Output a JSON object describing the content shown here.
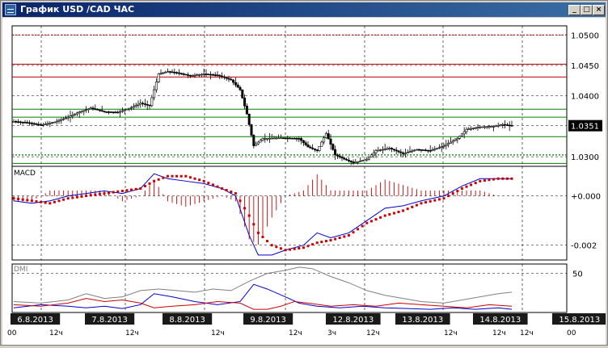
{
  "window": {
    "title": "График USD /CAD  ЧАС",
    "minimize_label": "_",
    "maximize_label": "□",
    "close_label": "×"
  },
  "colors": {
    "background": "#ffffff",
    "grid": "#000000",
    "resistance_line": "#c00000",
    "support_line": "#008000",
    "macd_line": "#0000cc",
    "signal_line": "#cc0000",
    "dmi_adx": "#808080",
    "dmi_plus": "#0000cc",
    "dmi_minus": "#cc0000",
    "date_label_bg": "#1a1a1a"
  },
  "chart_data": [
    {
      "type": "candlestick",
      "symbol": "USD /CAD",
      "timeframe": "ЧАС",
      "y_ticks": [
        "1.0500",
        "1.0450",
        "1.0400",
        "1.0351",
        "1.0300"
      ],
      "y_tick_values": [
        1.05,
        1.045,
        1.04,
        1.0351,
        1.03
      ],
      "current_price": "1.0351",
      "ylim": [
        1.0263,
        1.0515
      ],
      "horizontal_levels": {
        "dotted_red": [
          1.05
        ],
        "red": [
          1.0452,
          1.0431
        ],
        "green": [
          1.0378,
          1.0365,
          1.0333,
          1.0289,
          1.0279
        ],
        "dotted_green": [
          1.0303
        ]
      },
      "close_path": [
        [
          0,
          1.0358
        ],
        [
          6,
          1.0356
        ],
        [
          12,
          1.0352
        ],
        [
          18,
          1.0357
        ],
        [
          24,
          1.0365
        ],
        [
          28,
          1.0372
        ],
        [
          34,
          1.038
        ],
        [
          40,
          1.0374
        ],
        [
          46,
          1.0373
        ],
        [
          52,
          1.0381
        ],
        [
          56,
          1.0388
        ],
        [
          60,
          1.0384
        ],
        [
          64,
          1.0436
        ],
        [
          68,
          1.044
        ],
        [
          72,
          1.0438
        ],
        [
          78,
          1.0433
        ],
        [
          84,
          1.0436
        ],
        [
          90,
          1.0434
        ],
        [
          96,
          1.0426
        ],
        [
          100,
          1.041
        ],
        [
          103,
          1.037
        ],
        [
          106,
          1.0318
        ],
        [
          110,
          1.033
        ],
        [
          118,
          1.0331
        ],
        [
          126,
          1.033
        ],
        [
          130,
          1.0316
        ],
        [
          134,
          1.031
        ],
        [
          138,
          1.0338
        ],
        [
          142,
          1.0303
        ],
        [
          146,
          1.0296
        ],
        [
          150,
          1.029
        ],
        [
          156,
          1.0296
        ],
        [
          160,
          1.031
        ],
        [
          166,
          1.0314
        ],
        [
          172,
          1.0305
        ],
        [
          178,
          1.0312
        ],
        [
          184,
          1.031
        ],
        [
          190,
          1.0318
        ],
        [
          196,
          1.033
        ],
        [
          200,
          1.0345
        ],
        [
          206,
          1.0349
        ],
        [
          212,
          1.035
        ],
        [
          216,
          1.0353
        ],
        [
          220,
          1.0351
        ]
      ]
    },
    {
      "type": "line",
      "title": "MACD",
      "y_ticks": [
        "+0.000",
        "-0.002"
      ],
      "y_tick_values": [
        0,
        -0.002
      ],
      "ylim": [
        -0.0026,
        0.0012
      ],
      "series": [
        {
          "key": "macd",
          "points": [
            [
              0,
              -0.0002
            ],
            [
              8,
              -0.0003
            ],
            [
              16,
              -0.0002
            ],
            [
              24,
              0.0
            ],
            [
              32,
              0.0001
            ],
            [
              40,
              0.0002
            ],
            [
              48,
              0.0001
            ],
            [
              56,
              0.0003
            ],
            [
              62,
              0.0009
            ],
            [
              68,
              0.0007
            ],
            [
              76,
              0.0006
            ],
            [
              84,
              0.0005
            ],
            [
              92,
              0.0003
            ],
            [
              98,
              0.0
            ],
            [
              104,
              -0.0016
            ],
            [
              108,
              -0.0024
            ],
            [
              114,
              -0.0024
            ],
            [
              120,
              -0.0022
            ],
            [
              128,
              -0.002
            ],
            [
              134,
              -0.0015
            ],
            [
              140,
              -0.0017
            ],
            [
              148,
              -0.0015
            ],
            [
              156,
              -0.001
            ],
            [
              164,
              -0.0005
            ],
            [
              172,
              -0.0004
            ],
            [
              180,
              -0.0002
            ],
            [
              190,
              0.0
            ],
            [
              198,
              0.0004
            ],
            [
              206,
              0.0007
            ],
            [
              214,
              0.0007
            ],
            [
              220,
              0.0007
            ]
          ]
        },
        {
          "key": "signal",
          "points": [
            [
              0,
              -0.0001
            ],
            [
              8,
              -0.0002
            ],
            [
              16,
              -0.0003
            ],
            [
              24,
              -0.0001
            ],
            [
              32,
              0.0
            ],
            [
              40,
              0.0001
            ],
            [
              48,
              0.0002
            ],
            [
              56,
              0.0003
            ],
            [
              62,
              0.0006
            ],
            [
              68,
              0.0008
            ],
            [
              76,
              0.0008
            ],
            [
              84,
              0.0006
            ],
            [
              92,
              0.0003
            ],
            [
              98,
              0.0001
            ],
            [
              104,
              -0.0008
            ],
            [
              108,
              -0.0015
            ],
            [
              114,
              -0.002
            ],
            [
              120,
              -0.0022
            ],
            [
              128,
              -0.0021
            ],
            [
              134,
              -0.0019
            ],
            [
              140,
              -0.0018
            ],
            [
              148,
              -0.0016
            ],
            [
              156,
              -0.0011
            ],
            [
              164,
              -0.0008
            ],
            [
              172,
              -0.0006
            ],
            [
              180,
              -0.0003
            ],
            [
              190,
              -0.0001
            ],
            [
              198,
              0.0003
            ],
            [
              206,
              0.0006
            ],
            [
              214,
              0.0007
            ],
            [
              220,
              0.0007
            ]
          ]
        }
      ]
    },
    {
      "type": "line",
      "title": "DMI",
      "y_ticks": [
        "50"
      ],
      "y_tick_values": [
        50
      ],
      "ylim": [
        0,
        62
      ],
      "series": [
        {
          "key": "adx",
          "points": [
            [
              0,
              14
            ],
            [
              12,
              12
            ],
            [
              24,
              16
            ],
            [
              32,
              24
            ],
            [
              40,
              18
            ],
            [
              48,
              20
            ],
            [
              56,
              28
            ],
            [
              64,
              30
            ],
            [
              72,
              28
            ],
            [
              80,
              26
            ],
            [
              88,
              30
            ],
            [
              96,
              28
            ],
            [
              104,
              40
            ],
            [
              112,
              50
            ],
            [
              120,
              54
            ],
            [
              126,
              58
            ],
            [
              132,
              56
            ],
            [
              140,
              46
            ],
            [
              148,
              38
            ],
            [
              156,
              28
            ],
            [
              164,
              22
            ],
            [
              172,
              18
            ],
            [
              180,
              14
            ],
            [
              190,
              12
            ],
            [
              198,
              16
            ],
            [
              206,
              20
            ],
            [
              214,
              24
            ],
            [
              220,
              26
            ]
          ]
        },
        {
          "key": "plus",
          "points": [
            [
              0,
              6
            ],
            [
              12,
              10
            ],
            [
              24,
              8
            ],
            [
              32,
              6
            ],
            [
              40,
              8
            ],
            [
              48,
              5
            ],
            [
              56,
              10
            ],
            [
              62,
              24
            ],
            [
              70,
              20
            ],
            [
              80,
              14
            ],
            [
              90,
              10
            ],
            [
              100,
              14
            ],
            [
              106,
              36
            ],
            [
              112,
              30
            ],
            [
              120,
              20
            ],
            [
              126,
              12
            ],
            [
              134,
              8
            ],
            [
              144,
              6
            ],
            [
              154,
              8
            ],
            [
              164,
              6
            ],
            [
              174,
              5
            ],
            [
              184,
              4
            ],
            [
              194,
              6
            ],
            [
              204,
              4
            ],
            [
              214,
              6
            ],
            [
              220,
              4
            ]
          ]
        },
        {
          "key": "minus",
          "points": [
            [
              0,
              10
            ],
            [
              12,
              8
            ],
            [
              24,
              12
            ],
            [
              32,
              18
            ],
            [
              40,
              14
            ],
            [
              48,
              16
            ],
            [
              56,
              12
            ],
            [
              62,
              6
            ],
            [
              70,
              8
            ],
            [
              80,
              10
            ],
            [
              90,
              14
            ],
            [
              100,
              12
            ],
            [
              106,
              4
            ],
            [
              112,
              4
            ],
            [
              118,
              8
            ],
            [
              124,
              14
            ],
            [
              130,
              12
            ],
            [
              140,
              8
            ],
            [
              150,
              10
            ],
            [
              160,
              8
            ],
            [
              170,
              12
            ],
            [
              180,
              10
            ],
            [
              190,
              8
            ],
            [
              200,
              6
            ],
            [
              210,
              10
            ],
            [
              220,
              8
            ]
          ]
        }
      ]
    }
  ],
  "time_axis": {
    "date_labels": [
      "6.8.2013",
      "7.8.2013",
      "8.8.2013",
      "9.8.2013",
      "12.8.2013",
      "13.8.2013",
      "14.8.2013",
      "15.8.2013"
    ],
    "hour_labels": [
      "00",
      "12ч",
      "12ч",
      "12ч",
      "12ч",
      "3ч",
      "12ч",
      "12ч",
      "12ч",
      "12ч",
      "00"
    ]
  }
}
